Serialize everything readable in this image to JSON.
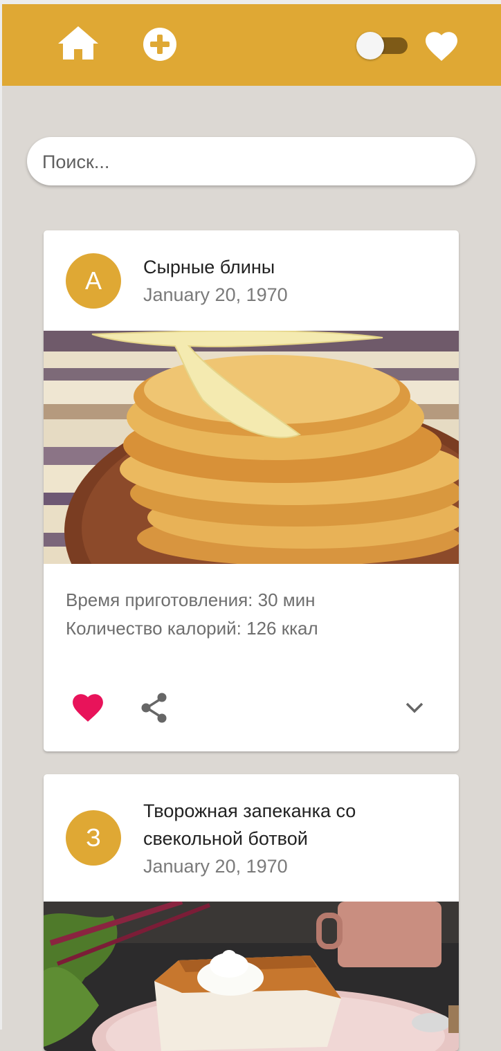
{
  "appbar": {
    "color": "#dfa834",
    "icons": [
      "home-icon",
      "add-circle-icon",
      "heart-icon"
    ],
    "theme_toggle_on": true
  },
  "search": {
    "placeholder": "Поиск..."
  },
  "recipes": [
    {
      "avatar": "А",
      "title": "Сырные блины",
      "date": "January 20, 1970",
      "time": "Время приготовления: 30 мин",
      "calories": "Количество калорий: 126 ккал",
      "liked": true,
      "like_color": "#e8135a"
    },
    {
      "avatar": "З",
      "title": "Творожная запеканка со свекольной ботвой",
      "date": "January 20, 1970"
    }
  ]
}
